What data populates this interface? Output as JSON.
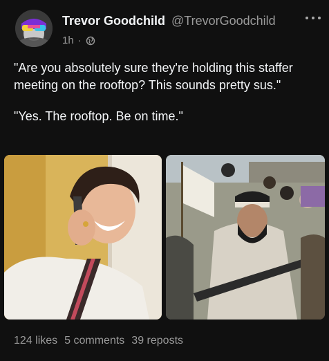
{
  "post": {
    "author": {
      "display_name": "Trevor Goodchild",
      "handle": "@TrevorGoodchild"
    },
    "time": "1h",
    "separator": "·",
    "visibility_icon": "globe-icon",
    "paragraphs": [
      "\"Are you absolutely sure they're holding this staffer meeting on the rooftop? This sounds pretty sus.\"",
      "\"Yes. The rooftop. Be on time.\""
    ],
    "images": [
      {
        "name": "smiling-man-on-phone-photo"
      },
      {
        "name": "armed-men-group-photo"
      }
    ],
    "stats": {
      "likes": "124 likes",
      "comments": "5 comments",
      "reposts": "39 reposts"
    }
  },
  "colors": {
    "background": "#101010",
    "primary_text": "#f3f5f7",
    "secondary_text": "#9a9a9a"
  }
}
